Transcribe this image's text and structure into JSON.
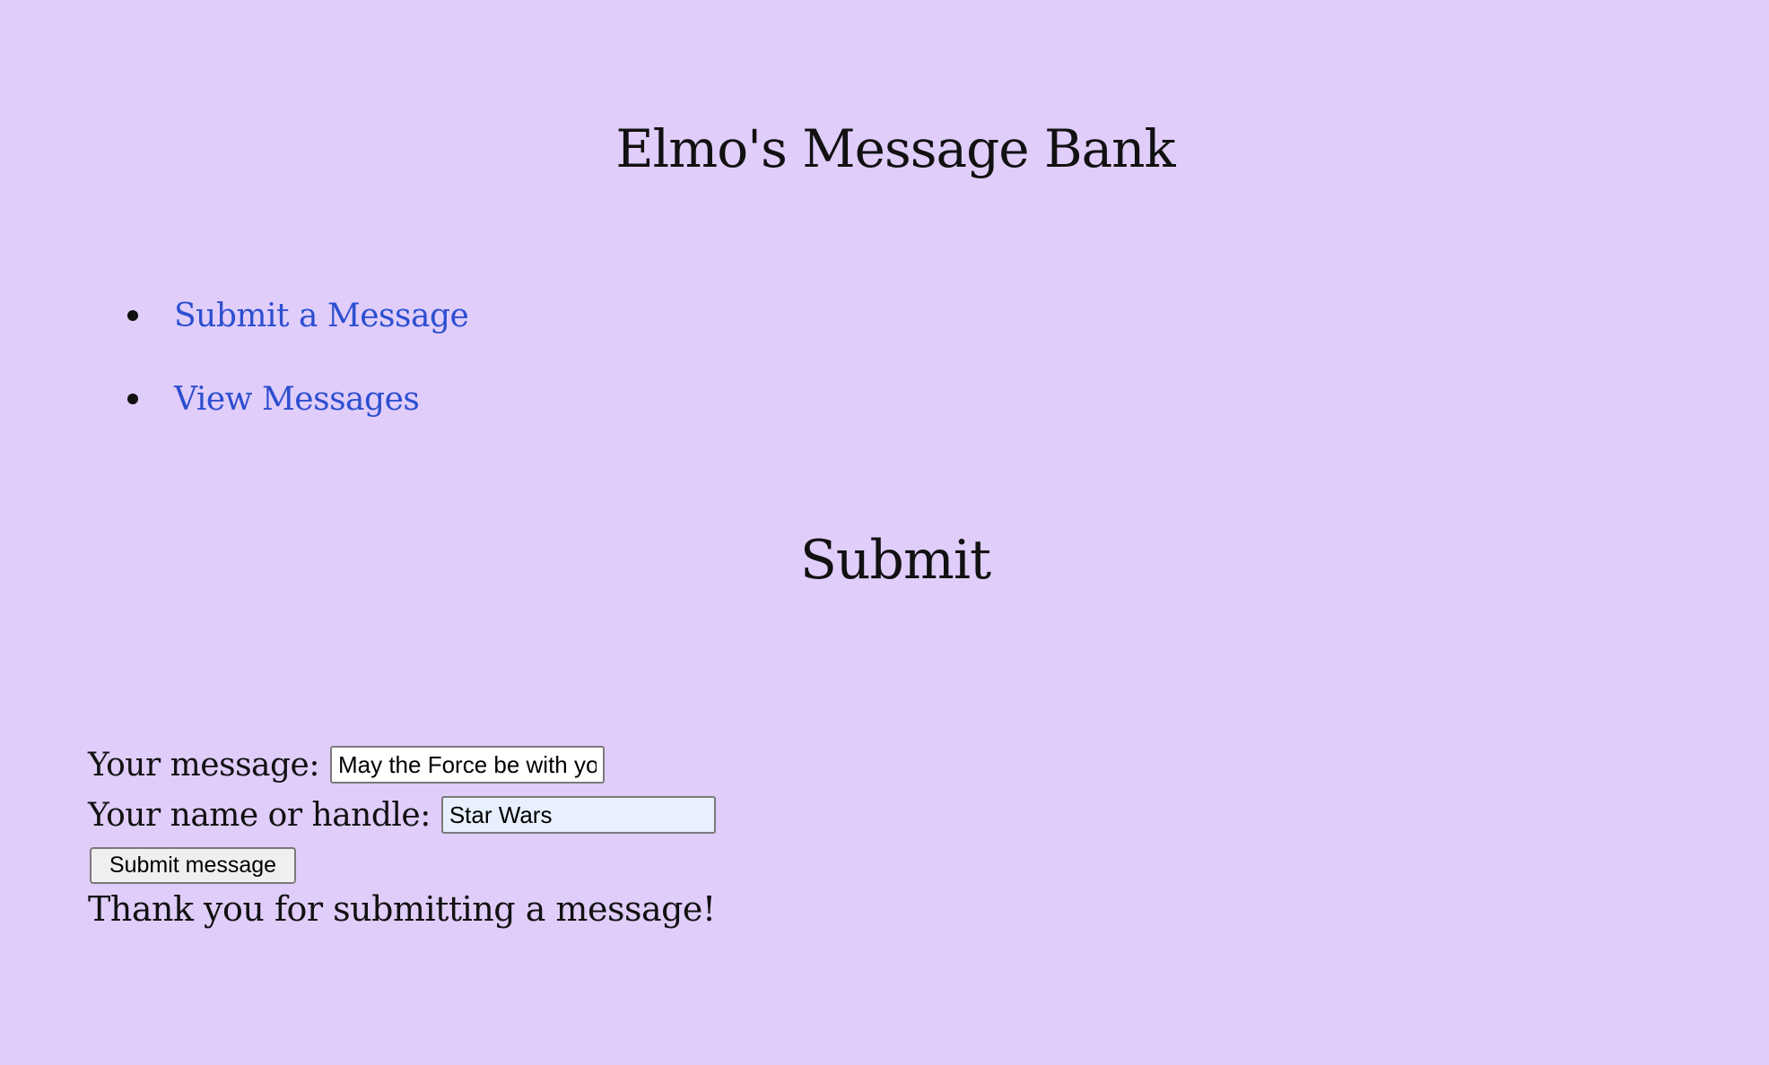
{
  "page": {
    "title": "Elmo's Message Bank",
    "background_color": "#e0cdfa"
  },
  "nav": {
    "items": [
      {
        "label": "Submit a Message"
      },
      {
        "label": "View Messages"
      }
    ],
    "link_color": "#2c4fd0"
  },
  "section": {
    "heading": "Submit"
  },
  "form": {
    "message_label": "Your message:",
    "message_value": "May the Force be with you",
    "name_label": "Your name or handle:",
    "name_value": "Star Wars",
    "submit_label": "Submit message"
  },
  "status": {
    "confirmation": "Thank you for submitting a message!"
  }
}
